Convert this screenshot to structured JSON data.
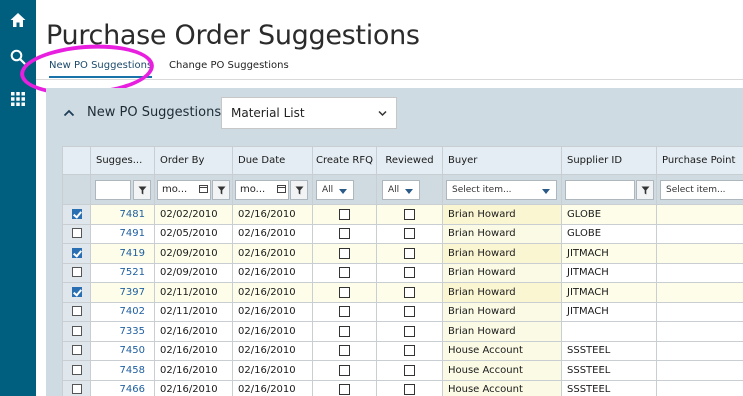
{
  "page": {
    "title": "Purchase Order Suggestions"
  },
  "tabs": [
    {
      "label": "New PO Suggestions",
      "active": true
    },
    {
      "label": "Change PO Suggestions",
      "active": false
    }
  ],
  "rail": {
    "icons": [
      "home-icon",
      "search-icon",
      "apps-grid-icon"
    ]
  },
  "panel": {
    "title": "New PO Suggestions",
    "view_select": "Material List"
  },
  "grid": {
    "columns": [
      "",
      "Sugges...",
      "Order By",
      "Due Date",
      "Create RFQ",
      "Reviewed",
      "Buyer",
      "Supplier ID",
      "Purchase Point"
    ],
    "filters": {
      "order_by": "mo...",
      "due_date": "mo...",
      "create_rfq": "All",
      "reviewed": "All",
      "buyer": "Select item...",
      "purchase_point": "Select item..."
    },
    "rows": [
      {
        "selected": true,
        "suggestion": "7481",
        "order_by": "02/02/2010",
        "due_date": "02/16/2010",
        "create_rfq": false,
        "reviewed": false,
        "buyer": "Brian Howard",
        "supplier": "GLOBE"
      },
      {
        "selected": false,
        "suggestion": "7491",
        "order_by": "02/05/2010",
        "due_date": "02/16/2010",
        "create_rfq": false,
        "reviewed": false,
        "buyer": "Brian Howard",
        "supplier": "GLOBE"
      },
      {
        "selected": true,
        "suggestion": "7419",
        "order_by": "02/09/2010",
        "due_date": "02/16/2010",
        "create_rfq": false,
        "reviewed": false,
        "buyer": "Brian Howard",
        "supplier": "JITMACH"
      },
      {
        "selected": false,
        "suggestion": "7521",
        "order_by": "02/09/2010",
        "due_date": "02/16/2010",
        "create_rfq": false,
        "reviewed": false,
        "buyer": "Brian Howard",
        "supplier": "JITMACH"
      },
      {
        "selected": true,
        "suggestion": "7397",
        "order_by": "02/11/2010",
        "due_date": "02/16/2010",
        "create_rfq": false,
        "reviewed": false,
        "buyer": "Brian Howard",
        "supplier": "JITMACH"
      },
      {
        "selected": false,
        "suggestion": "7402",
        "order_by": "02/11/2010",
        "due_date": "02/16/2010",
        "create_rfq": false,
        "reviewed": false,
        "buyer": "Brian Howard",
        "supplier": "JITMACH"
      },
      {
        "selected": false,
        "suggestion": "7335",
        "order_by": "02/16/2010",
        "due_date": "02/16/2010",
        "create_rfq": false,
        "reviewed": false,
        "buyer": "Brian Howard",
        "supplier": ""
      },
      {
        "selected": false,
        "suggestion": "7450",
        "order_by": "02/16/2010",
        "due_date": "02/16/2010",
        "create_rfq": false,
        "reviewed": false,
        "buyer": "House Account",
        "supplier": "SSSTEEL"
      },
      {
        "selected": false,
        "suggestion": "7458",
        "order_by": "02/16/2010",
        "due_date": "02/16/2010",
        "create_rfq": false,
        "reviewed": false,
        "buyer": "House Account",
        "supplier": "SSSTEEL"
      },
      {
        "selected": false,
        "suggestion": "7466",
        "order_by": "02/16/2010",
        "due_date": "02/16/2010",
        "create_rfq": false,
        "reviewed": false,
        "buyer": "House Account",
        "supplier": "SSSTEEL"
      }
    ]
  },
  "colors": {
    "rail": "#005e7f",
    "accent": "#1a73a8",
    "highlight_ring": "#e91fe0",
    "panel_bg": "#cfdbe2",
    "header_bg": "#e4edf3"
  }
}
